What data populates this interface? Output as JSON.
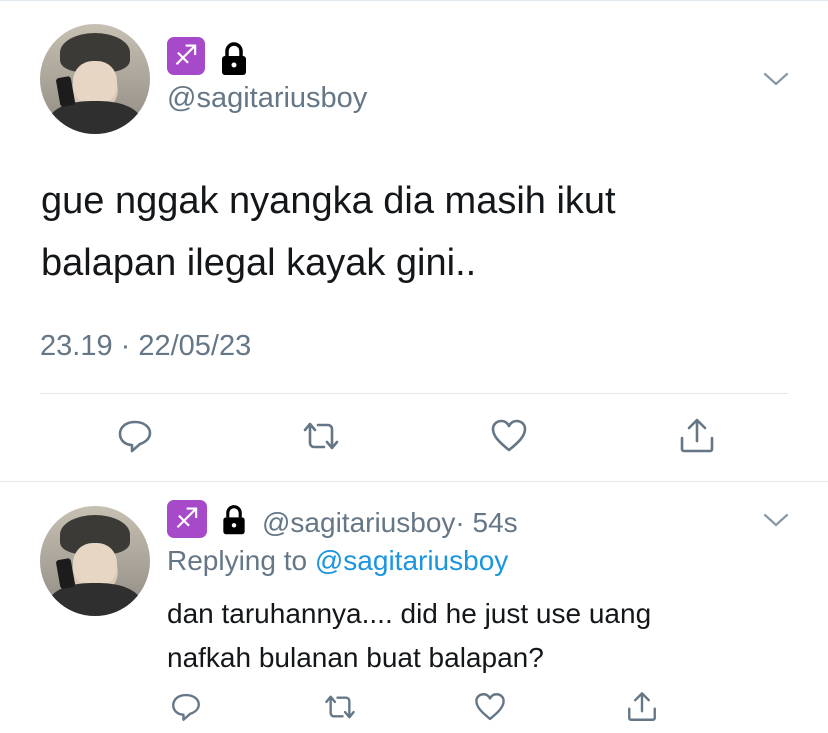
{
  "main_tweet": {
    "avatar_alt": "profile photo",
    "zodiac_emoji": "♐",
    "handle": "@sagitariusboy",
    "text_line1": "gue nggak nyangka dia masih ikut",
    "text_line2": "balapan ilegal kayak gini..",
    "timestamp": "23.19 · 22/05/23"
  },
  "reply_tweet": {
    "zodiac_emoji": "♐",
    "handle": "@sagitariusboy",
    "age": "· 54s",
    "replying_prefix": "Replying to",
    "replying_handle": "@sagitariusboy",
    "text_line1": "dan taruhannya.... did he just use uang",
    "text_line2": "nafkah bulanan buat balapan?"
  },
  "icons": {
    "reply": "reply-icon",
    "retweet": "retweet-icon",
    "like": "heart-icon",
    "share": "share-icon",
    "menu": "chevron-down-icon",
    "lock": "lock-icon"
  },
  "colors": {
    "text": "#14171a",
    "secondary": "#657786",
    "link": "#1b95e0",
    "divider": "#e1e8ed",
    "zodiac_bg": "#a64ac9"
  }
}
